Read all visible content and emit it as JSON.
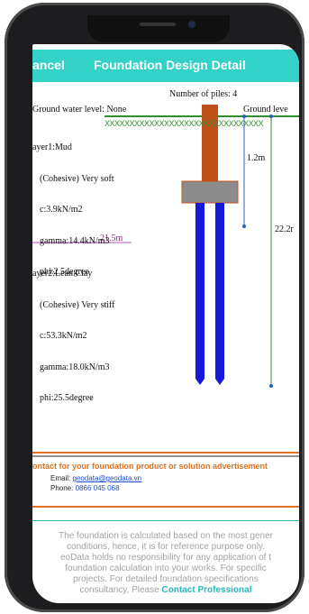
{
  "header": {
    "cancel_label": "ancel",
    "title": "Foundation Design Detail",
    "bar_color": "#33d1c8"
  },
  "diagram": {
    "piles_label": "Number of piles: 4",
    "groundwater_label": "Ground water level: None",
    "ground_level_label": "Ground leve",
    "pile_cap_depth": "1.2m",
    "pile_length": "22.2r",
    "layer_boundary_depth": "21.5m",
    "layers": [
      {
        "name": "ayer1:Mud",
        "type": "(Cohesive) Very soft",
        "c": "c:3.9kN/m2",
        "gamma": "gamma:14.4kN/m3",
        "phi": "phi:2.5degree"
      },
      {
        "name": "ayer2:Lean Clay",
        "type": "(Cohesive) Very stiff",
        "c": "c:53.3kN/m2",
        "gamma": "gamma:18.0kN/m3",
        "phi": "phi:25.5degree"
      }
    ],
    "colors": {
      "ground_line": "#2f8f2f",
      "column": "#c0501a",
      "pile_cap": "#8c8c8c",
      "piles": "#1418d8",
      "dimension": "#2060c0",
      "boundary": "#b84fb8"
    }
  },
  "advertisement": {
    "headline": "ontact for your foundation product or solution advertisement",
    "email_label": "Email:",
    "email": "geodata@geodata.vn",
    "phone_label": "Phone:",
    "phone": "0866 045 068",
    "rule_color": "#e07020"
  },
  "disclaimer": {
    "line1": "The foundation is calculated based on the most gener",
    "line2": "conditions, hence, it is for reference purpose only.",
    "line3": "eoData holds no responsibility for any application of t",
    "line4": "foundation calculation into your works. For specific",
    "line5": "projects. For detailed foundation specifications",
    "line6_prefix": "consultancy, Please ",
    "contact_link": "Contact Professional"
  }
}
